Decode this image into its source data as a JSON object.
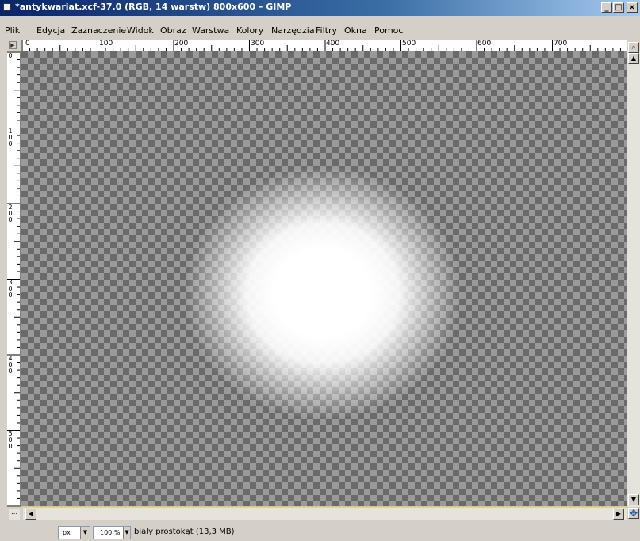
{
  "window": {
    "title": "*antykwariat.xcf-37.0 (RGB, 14 warstw) 800x600 – GIMP",
    "minimize_symbol": "_",
    "maximize_symbol": "□",
    "close_symbol": "×"
  },
  "menu": {
    "items": [
      "Plik",
      "Edycja",
      "Zaznaczenie",
      "Widok",
      "Obraz",
      "Warstwa",
      "Kolory",
      "Narzędzia",
      "Filtry",
      "Okna",
      "Pomoc"
    ]
  },
  "rulers": {
    "horizontal_labels": [
      "0",
      "100",
      "200",
      "300",
      "400",
      "500",
      "600",
      "700"
    ],
    "vertical_labels": [
      "0",
      "1\n0\n0",
      "2\n0\n0",
      "3\n0\n0",
      "4\n0\n0",
      "5\n0\n0"
    ],
    "corner_symbol": "▶"
  },
  "icons": {
    "corner": "ruler-corner-icon",
    "navigate": "navigate-icon",
    "zoom": "zoom-icon",
    "quickmask": "quickmask-icon",
    "scroll_up": "arrow-up-icon",
    "scroll_down": "arrow-down-icon",
    "scroll_left": "arrow-left-icon",
    "scroll_right": "arrow-right-icon"
  },
  "status": {
    "unit": "px",
    "zoom": "100 %",
    "message": "biały prostokąt (13,3 MB)"
  },
  "colors": {
    "title_gradient_start": "#0a246a",
    "title_gradient_end": "#a6caf0",
    "checker_dark": "#6a6a6a",
    "checker_light": "#9a9a9a",
    "selection_border": "#e8d000"
  }
}
